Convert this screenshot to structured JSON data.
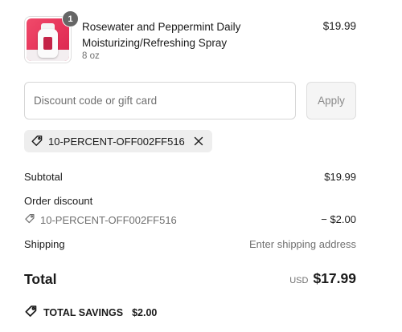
{
  "product": {
    "quantity": "1",
    "title": "Rosewater and Peppermint Daily Moisturizing/Refreshing Spray",
    "variant": "8 oz",
    "price": "$19.99"
  },
  "discount": {
    "placeholder": "Discount code or gift card",
    "apply_label": "Apply",
    "applied_code": "10-PERCENT-OFF002FF516"
  },
  "summary": {
    "subtotal_label": "Subtotal",
    "subtotal_value": "$19.99",
    "order_discount_label": "Order discount",
    "discount_code": "10-PERCENT-OFF002FF516",
    "discount_value": "− $2.00",
    "shipping_label": "Shipping",
    "shipping_value": "Enter shipping address"
  },
  "total": {
    "label": "Total",
    "currency": "USD",
    "value": "$17.99"
  },
  "savings": {
    "label": "TOTAL SAVINGS",
    "value": "$2.00"
  },
  "icons": {
    "tag": "tag-icon",
    "close": "close-icon",
    "savings_tag": "savings-tag-icon"
  },
  "colors": {
    "text": "#1a1a1a",
    "muted": "#707070",
    "chip_bg": "#eeeeee",
    "badge_bg": "#666666",
    "product_pink": "#e6345a"
  }
}
